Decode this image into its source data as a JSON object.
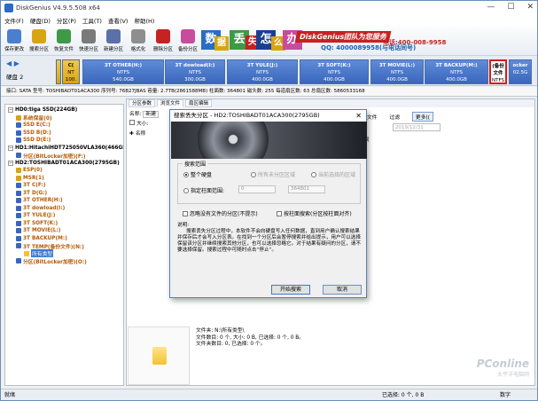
{
  "window": {
    "title": "DiskGenius V4.9.5.508 x64"
  },
  "menu": [
    "文件(F)",
    "硬盘(D)",
    "分区(P)",
    "工具(T)",
    "查看(V)",
    "帮助(H)"
  ],
  "toolbar": [
    {
      "label": "保存更改",
      "icon": "save-icon",
      "color": "#4a7fd0"
    },
    {
      "label": "搜索分区",
      "icon": "search-icon",
      "color": "#d9a411"
    },
    {
      "label": "恢复文件",
      "icon": "recover-icon",
      "color": "#3d9a45"
    },
    {
      "label": "快速分区",
      "icon": "quick-partition-icon",
      "color": "#7a7a7a"
    },
    {
      "label": "新建分区",
      "icon": "new-partition-icon",
      "color": "#5b6fa8"
    },
    {
      "label": "格式化",
      "icon": "format-icon",
      "color": "#8e8e8e"
    },
    {
      "label": "删除分区",
      "icon": "delete-partition-icon",
      "color": "#c52222"
    },
    {
      "label": "备份分区",
      "icon": "backup-partition-icon",
      "color": "#c94b9e"
    }
  ],
  "banner": {
    "chars": [
      "数",
      "据",
      "丢",
      "失",
      "怎",
      "么",
      "办"
    ],
    "brand": "DiskGenius团队为您服务",
    "phone": "电话:400-008-9958",
    "qq": "QQ: 4000089958(与电话同号)"
  },
  "diskmap": {
    "nav": "◀ ▶",
    "disk_label": "硬盘 2",
    "partitions": [
      {
        "name": "",
        "fs": "",
        "size": "",
        "kind": "small"
      },
      {
        "name": "C(",
        "fs": "NT",
        "size": "100.",
        "kind": "small"
      },
      {
        "name": "3T OTHER(H:)",
        "fs": "NTFS",
        "size": "540.0GB",
        "kind": "normal"
      },
      {
        "name": "3T dowload(I:)",
        "fs": "NTFS",
        "size": "300.0GB",
        "kind": "normal"
      },
      {
        "name": "3T YULE(J:)",
        "fs": "NTFS",
        "size": "400.0GB",
        "kind": "normal"
      },
      {
        "name": "3T SOFT(K:)",
        "fs": "NTFS",
        "size": "400.0GB",
        "kind": "normal"
      },
      {
        "name": "3T MOVIE(L:)",
        "fs": "NTFS",
        "size": "400.0GB",
        "kind": "normal"
      },
      {
        "name": "3T BACKUP(M:)",
        "fs": "NTFS",
        "size": "400.0GB",
        "kind": "normal"
      },
      {
        "name": "(备份文件",
        "fs": "NTFS",
        "size": "31.8G",
        "kind": "red"
      },
      {
        "name": "ocker",
        "fs": "",
        "size": "02.5G",
        "kind": "normal"
      }
    ]
  },
  "infobar": "接口: SATA   型号: TOSHIBADT01ACA300   序列号: 76B27JBAS   容量: 2.7TB(2861588MB)   柱面数: 364801   磁头数: 255   每道扇区数: 63   总扇区数: 5860533168",
  "tree": [
    {
      "indent": 0,
      "text": "HD0:tiga SSD(224GB)",
      "type": "disk",
      "color": ""
    },
    {
      "indent": 1,
      "text": "系统保留(0)",
      "type": "part",
      "color": "#d9a411"
    },
    {
      "indent": 1,
      "text": "SSD E(C:)",
      "type": "part",
      "color": "#3a66bd"
    },
    {
      "indent": 1,
      "text": "SSD B(D:)",
      "type": "part",
      "color": "#3a66bd"
    },
    {
      "indent": 1,
      "text": "SSD D(E:)",
      "type": "part",
      "color": "#3a66bd"
    },
    {
      "indent": 0,
      "text": "HD1:HitachiHDT725050VLA360(466GB",
      "type": "disk",
      "color": ""
    },
    {
      "indent": 1,
      "text": "分区(BitLocker加密)(F:)",
      "type": "part",
      "color": "#3a66bd"
    },
    {
      "indent": 0,
      "text": "HD2:TOSHIBADT01ACA300(2795GB)",
      "type": "disk",
      "color": ""
    },
    {
      "indent": 1,
      "text": "ESP(0)",
      "type": "part",
      "color": "#d9a411"
    },
    {
      "indent": 1,
      "text": "MSR(1)",
      "type": "part",
      "color": "#d9a411"
    },
    {
      "indent": 1,
      "text": "3T C(F:)",
      "type": "part",
      "color": "#3a66bd"
    },
    {
      "indent": 1,
      "text": "3T D(G:)",
      "type": "part",
      "color": "#3a66bd"
    },
    {
      "indent": 1,
      "text": "3T OTHER(H:)",
      "type": "part",
      "color": "#3a66bd"
    },
    {
      "indent": 1,
      "text": "3T dowload(I:)",
      "type": "part",
      "color": "#3a66bd"
    },
    {
      "indent": 1,
      "text": "3T YULE(J:)",
      "type": "part",
      "color": "#3a66bd"
    },
    {
      "indent": 1,
      "text": "3T SOFT(K:)",
      "type": "part",
      "color": "#3a66bd"
    },
    {
      "indent": 1,
      "text": "3T MOVIE(L:)",
      "type": "part",
      "color": "#3a66bd"
    },
    {
      "indent": 1,
      "text": "3T BACKUP(M:)",
      "type": "part",
      "color": "#3a66bd"
    },
    {
      "indent": 1,
      "text": "3T TEMP(备份文件)(N:)",
      "type": "part",
      "color": "#3a66bd"
    },
    {
      "indent": 2,
      "text": "所有类型",
      "type": "sel",
      "color": "#f3c234"
    },
    {
      "indent": 1,
      "text": "分区(BitLocker加密)(O:)",
      "type": "part",
      "color": "#3a66bd"
    }
  ],
  "right": {
    "tabs": [
      "分区参数",
      "浏览文件",
      "扇区编辑"
    ],
    "path_label": "名称:",
    "path_value": "新建",
    "size_label": "大小:",
    "col_name": "名称",
    "filter_labels": [
      "文件",
      "过滤",
      "更多(("
    ],
    "date_placeholder": "2019/12/31",
    "col_modified": "时间",
    "summary": "文件夹: N:\\所有类型\\\n文件数目: 0 个, 大小: 0 B, 已选择: 0 个, 0 B。\n文件夹数目: 0, 已选择: 0 个。"
  },
  "watermark": {
    "brand": "PConline",
    "sub": "太平洋电脑网"
  },
  "status": {
    "left": "就绪",
    "selected": "已选择: 0 个, 0 B",
    "mode": "数字"
  },
  "dialog": {
    "title": "搜索丢失分区 - HD2:TOSHIBADT01ACA300(2795GB)",
    "group_title": "搜索范围",
    "opt_whole": "整个硬盘",
    "opt_unalloc": "所有未分区区域",
    "opt_selected": "当前选择的区域",
    "opt_cyl": "指定柱面范围:",
    "cyl_from": "0",
    "cyl_to": "364801",
    "chk_skip": "忽略没有文件的分区(不提示)",
    "chk_cyl": "按柱面搜索(分区按柱面对齐)",
    "desc_title": "说明:",
    "desc": "搜索丢失分区过程中，本软件不会向硬盘写入任何数据，直到用户确认搜索结果并保存后才会写入分区表。在找到一个分区后会暂停搜索并给出提示，用户可以选择保留该分区并继续搜索其他分区，也可以选择忽略它。对于结果有疑问的分区，请不要选择保留。搜索过程中可随时点击“停止”。",
    "btn_start": "开始搜索",
    "btn_cancel": "取消"
  }
}
